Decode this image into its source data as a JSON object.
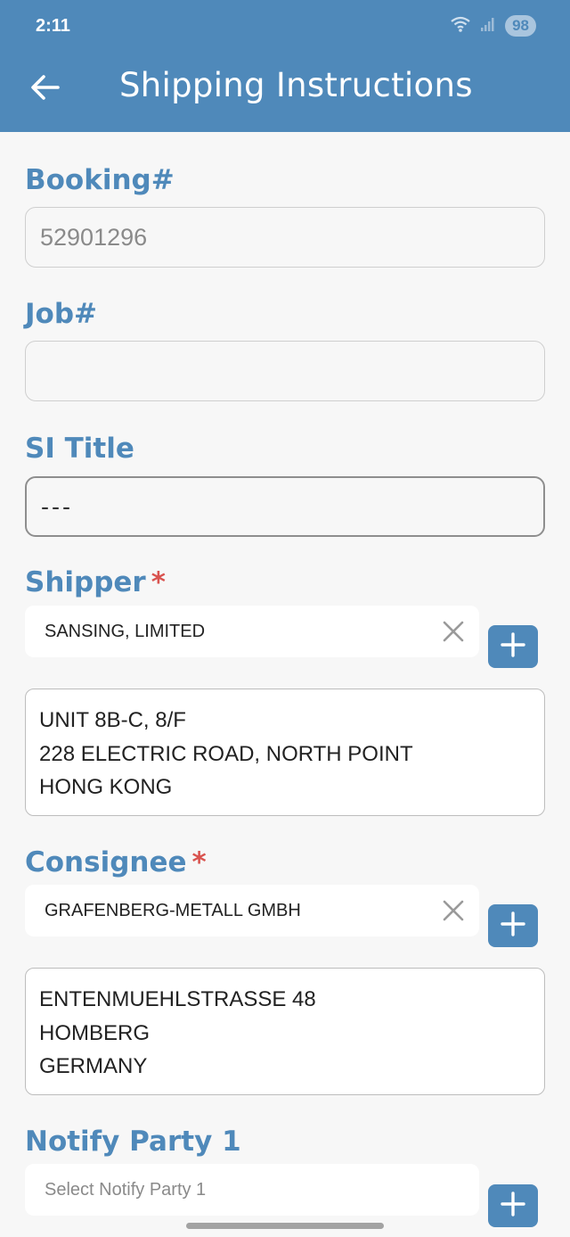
{
  "status_bar": {
    "time": "2:11",
    "battery": "98"
  },
  "header": {
    "title": "Shipping Instructions"
  },
  "form": {
    "booking": {
      "label": "Booking#",
      "value": "52901296"
    },
    "job": {
      "label": "Job#",
      "value": ""
    },
    "si_title": {
      "label": "SI Title",
      "value": "---"
    },
    "shipper": {
      "label": "Shipper",
      "required_mark": "*",
      "selected": "SANSING, LIMITED",
      "address_lines": [
        "UNIT 8B-C, 8/F",
        "228 ELECTRIC ROAD, NORTH POINT",
        "HONG KONG"
      ]
    },
    "consignee": {
      "label": "Consignee",
      "required_mark": "*",
      "selected": "GRAFENBERG-METALL GMBH",
      "address_lines": [
        "ENTENMUEHLSTRASSE 48",
        "HOMBERG",
        "GERMANY"
      ]
    },
    "notify_party_1": {
      "label": "Notify Party 1",
      "placeholder": "Select Notify Party 1"
    }
  },
  "icons": {
    "back": "arrow-left-icon",
    "clear": "close-icon",
    "add": "plus-icon",
    "wifi": "wifi-icon",
    "signal": "signal-icon"
  },
  "colors": {
    "primary": "#4f89ba",
    "required": "#d9534f",
    "background": "#f7f7f7"
  }
}
